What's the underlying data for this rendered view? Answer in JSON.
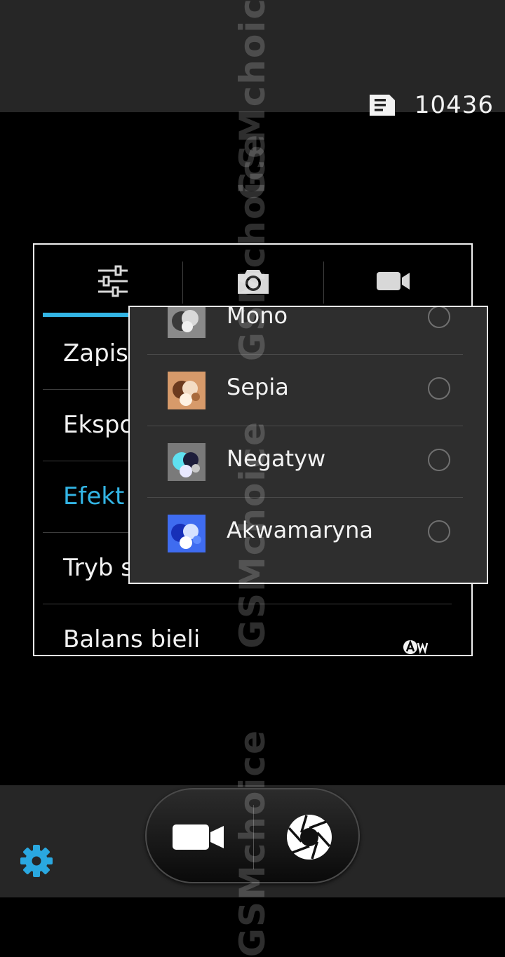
{
  "status": {
    "storage_icon": "sd-card-icon",
    "remaining_shots": "10436"
  },
  "settings_panel": {
    "tabs": [
      {
        "icon": "sliders-icon",
        "selected": true
      },
      {
        "icon": "camera-icon",
        "selected": false
      },
      {
        "icon": "video-camera-icon",
        "selected": false
      }
    ],
    "rows": [
      {
        "label": "Zapis"
      },
      {
        "label": "Ekspo"
      },
      {
        "label": "Efekt k",
        "active": true
      },
      {
        "label": "Tryb s"
      },
      {
        "label": "Balans bieli",
        "value_icon": "auto-white-balance-icon"
      }
    ]
  },
  "effect_popup": {
    "options": [
      {
        "label": "Mono",
        "selected": false
      },
      {
        "label": "Sepia",
        "selected": false
      },
      {
        "label": "Negatyw",
        "selected": false
      },
      {
        "label": "Akwamaryna",
        "selected": false
      }
    ]
  },
  "bottom_bar": {
    "settings_icon": "gear-icon",
    "video_icon": "video-camera-icon",
    "shutter_icon": "shutter-icon"
  },
  "colors": {
    "accent": "#33b5e5",
    "background": "#000000",
    "bar": "#262626",
    "popup": "#2e2e2e"
  },
  "watermark": {
    "text": "GSMchoice"
  }
}
